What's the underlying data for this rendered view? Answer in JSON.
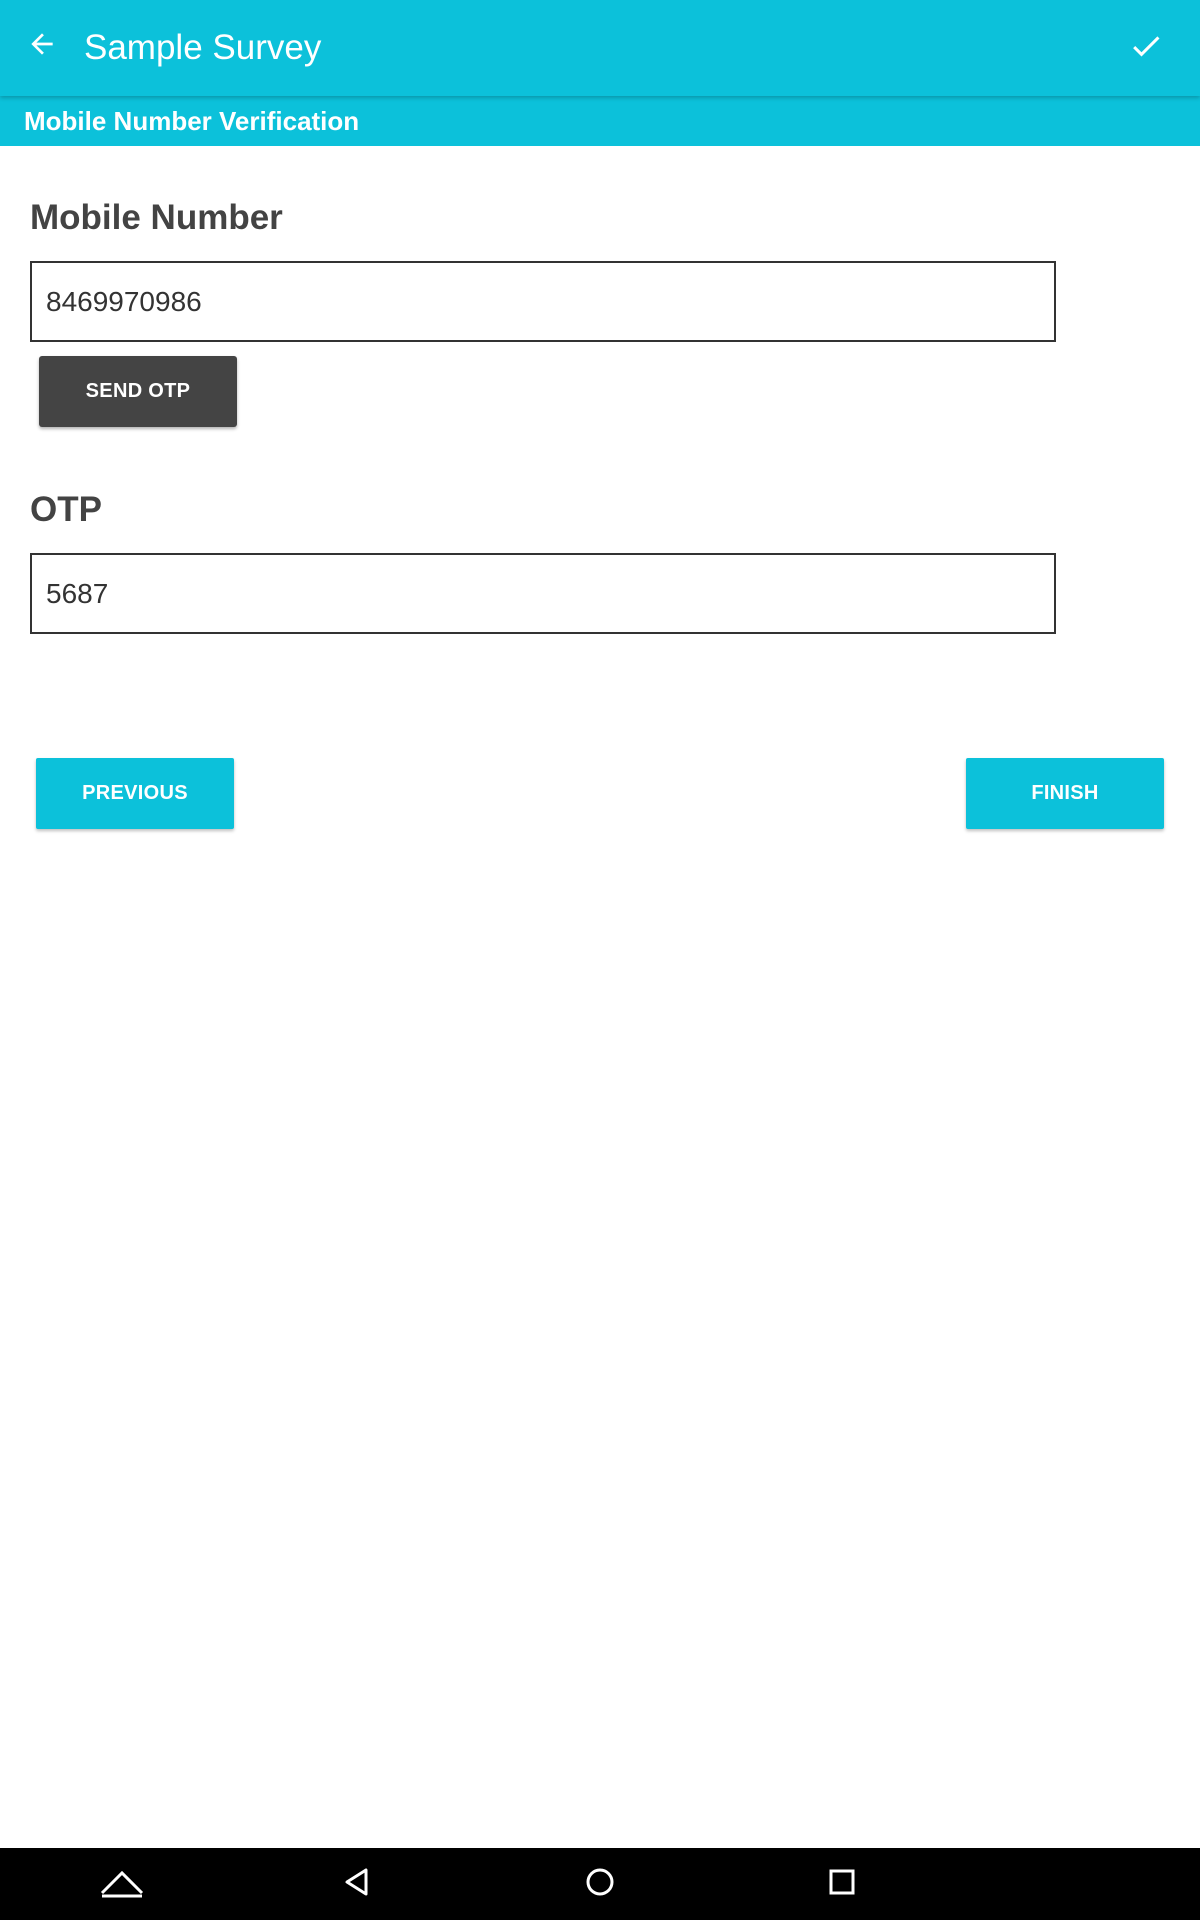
{
  "app_bar": {
    "title": "Sample Survey",
    "back_icon": "arrow-left-icon",
    "confirm_icon": "check-icon",
    "color": "#0cc1da"
  },
  "section": {
    "title": "Mobile Number Verification"
  },
  "form": {
    "mobile": {
      "label": "Mobile Number",
      "value": "8469970986"
    },
    "send_otp_label": "SEND OTP",
    "otp": {
      "label": "OTP",
      "value": "5687"
    }
  },
  "navigation": {
    "previous_label": "PREVIOUS",
    "finish_label": "FINISH"
  },
  "system_nav": {
    "icons": [
      "chevron-up-icon",
      "back-triangle-icon",
      "home-circle-icon",
      "recents-square-icon"
    ]
  }
}
